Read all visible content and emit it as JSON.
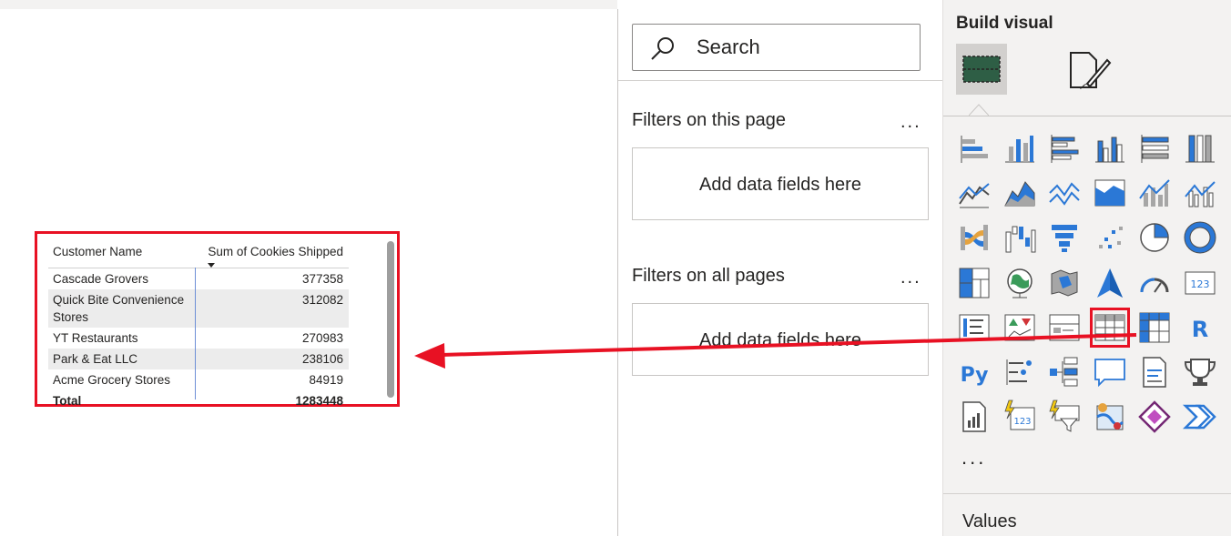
{
  "table_visual": {
    "columns": [
      "Customer Name",
      "Sum of Cookies Shipped"
    ],
    "rows": [
      {
        "name": "Cascade Grovers",
        "value": "377358"
      },
      {
        "name": "Quick Bite Convenience Stores",
        "value": "312082"
      },
      {
        "name": "YT Restaurants",
        "value": "270983"
      },
      {
        "name": "Park & Eat LLC",
        "value": "238106"
      },
      {
        "name": "Acme Grocery Stores",
        "value": "84919"
      }
    ],
    "total": {
      "label": "Total",
      "value": "1283448"
    }
  },
  "filters": {
    "search_placeholder": "Search",
    "page_section": "Filters on this page",
    "all_section": "Filters on all pages",
    "more": "...",
    "drop_hint": "Add data fields here"
  },
  "build_visual": {
    "title": "Build visual",
    "more": "...",
    "values_label": "Values",
    "icons": [
      "stacked-bar-chart-icon",
      "stacked-column-chart-icon",
      "clustered-bar-chart-icon",
      "clustered-column-chart-icon",
      "100-stacked-bar-chart-icon",
      "100-stacked-column-chart-icon",
      "line-chart-icon",
      "area-chart-icon",
      "stacked-area-chart-icon",
      "100-stacked-area-chart-icon",
      "line-and-stacked-column-chart-icon",
      "line-and-clustered-column-chart-icon",
      "ribbon-chart-icon",
      "waterfall-chart-icon",
      "funnel-icon",
      "scatter-chart-icon",
      "pie-chart-icon",
      "donut-chart-icon",
      "treemap-icon",
      "map-icon",
      "filled-map-icon",
      "azure-map-icon",
      "gauge-icon",
      "card-icon",
      "multi-row-card-icon",
      "kpi-icon",
      "slicer-icon",
      "table-icon",
      "matrix-icon",
      "r-script-icon",
      "python-visual-icon",
      "key-influencers-icon",
      "decomposition-tree-icon",
      "qa-icon",
      "smart-narrative-icon",
      "goals-icon",
      "paginated-report-icon",
      "power-apps-card-icon",
      "power-apps-filter-icon",
      "arcgis-map-icon",
      "power-apps-icon",
      "power-automate-icon"
    ],
    "colors": {
      "accent": "#2b78d6",
      "selection": "#e81123",
      "pane": "#f3f2f1"
    }
  },
  "annotation": {
    "arrow_color": "#e81123"
  }
}
